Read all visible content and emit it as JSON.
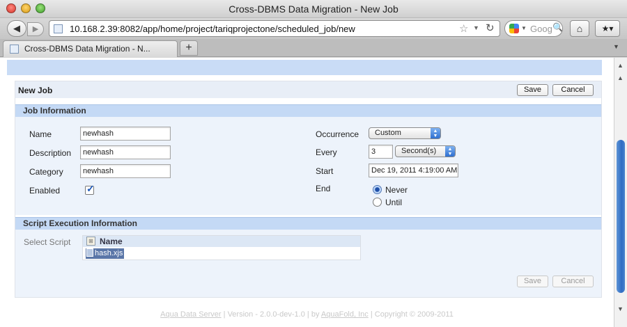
{
  "window": {
    "title": "Cross-DBMS Data Migration - New Job"
  },
  "browser": {
    "url": "10.168.2.39:8082/app/home/project/tariqprojectone/scheduled_job/new",
    "search_placeholder": "Goog",
    "tab_label": "Cross-DBMS Data Migration - N...",
    "new_tab_label": "+"
  },
  "job": {
    "title": "New Job",
    "save_label": "Save",
    "cancel_label": "Cancel"
  },
  "job_info": {
    "heading": "Job Information",
    "name_label": "Name",
    "name_value": "newhash",
    "description_label": "Description",
    "description_value": "newhash",
    "category_label": "Category",
    "category_value": "newhash",
    "enabled_label": "Enabled",
    "enabled_checked": true,
    "occurrence_label": "Occurrence",
    "occurrence_value": "Custom",
    "every_label": "Every",
    "every_value": "3",
    "every_unit": "Second(s)",
    "start_label": "Start",
    "start_value": "Dec 19, 2011 4:19:00 AM",
    "end_label": "End",
    "end_never": "Never",
    "end_until": "Until",
    "end_selected": "Never"
  },
  "script_info": {
    "heading": "Script Execution Information",
    "select_label": "Select Script",
    "column_header": "Name",
    "scripts": [
      "hash.xjs"
    ]
  },
  "footer": {
    "product_link": "Aqua Data Server",
    "version_text": "| Version - 2.0.0-dev-1.0 | by",
    "company_link": "AquaFold, Inc",
    "copyright": "| Copyright © 2009-2011"
  },
  "colors": {
    "section_header": "#c4d9f5",
    "section_body": "#edf3fb",
    "selection": "#5a76a8",
    "scroll_thumb": "#2f6cc3"
  }
}
